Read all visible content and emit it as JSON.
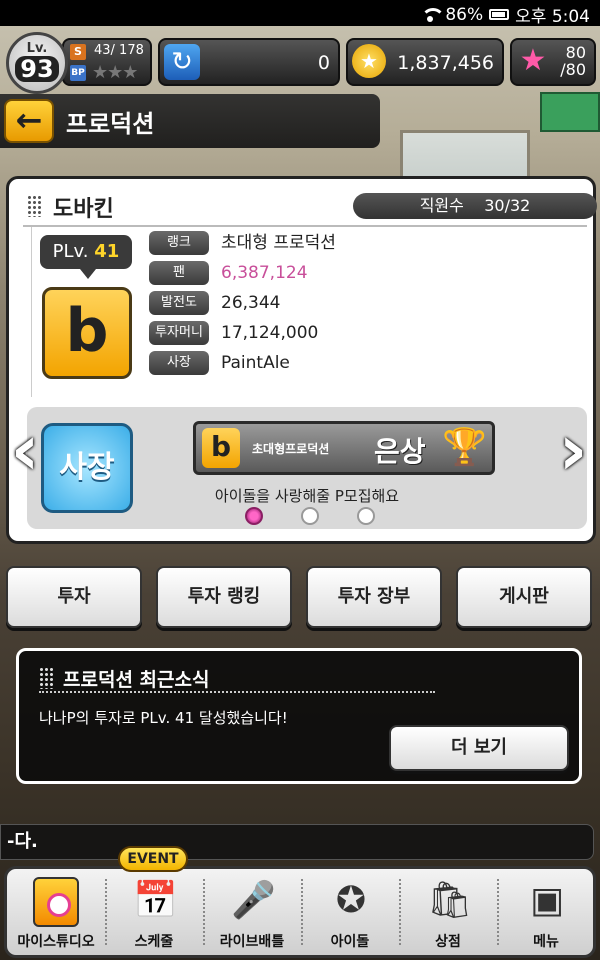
{
  "status_bar": {
    "battery": "86%",
    "time": "오후 5:04"
  },
  "top_stats": {
    "level_label": "Lv.",
    "level": "93",
    "rank_badge": "S",
    "bp_badge": "BP",
    "exp": "43/ 178",
    "stars": "★★★",
    "gems": "0",
    "coins": "1,837,456",
    "stamina_line1": "80",
    "stamina_line2": "/80"
  },
  "header": {
    "title": "프로덕션"
  },
  "production": {
    "name": "도바킨",
    "staff_label": "직원수",
    "staff_value": "30/32",
    "plv_label": "PLv.",
    "plv_value": "41",
    "logo_letter": "b",
    "info": [
      {
        "label": "랭크",
        "value": "초대형 프로덕션"
      },
      {
        "label": "팬",
        "value": "6,387,124"
      },
      {
        "label": "발전도",
        "value": "26,344"
      },
      {
        "label": "투자머니",
        "value": "17,124,000"
      },
      {
        "label": "사장",
        "value": "PaintAle"
      }
    ],
    "president_button": "사장",
    "award": {
      "logo_letter": "b",
      "text": "초대형프로덕션",
      "rank": "은상"
    },
    "slogan": "아이돌을 사랑해줄 P모집해요"
  },
  "actions": [
    "투자",
    "투자 랭킹",
    "투자 장부",
    "게시판"
  ],
  "news": {
    "title": "프로덕션 최근소식",
    "body": "나나P의 투자로 PLv. 41 달성했습니다!",
    "more_button": "더 보기"
  },
  "ticker": "-다.",
  "nav": {
    "event_badge": "EVENT",
    "items": [
      "마이스튜디오",
      "스케줄",
      "라이브배틀",
      "아이돌",
      "상점",
      "메뉴"
    ]
  },
  "colors": {
    "accent_pink": "#c84f9a",
    "gold": "#f3a400",
    "plv_value": "#ffd52a"
  }
}
